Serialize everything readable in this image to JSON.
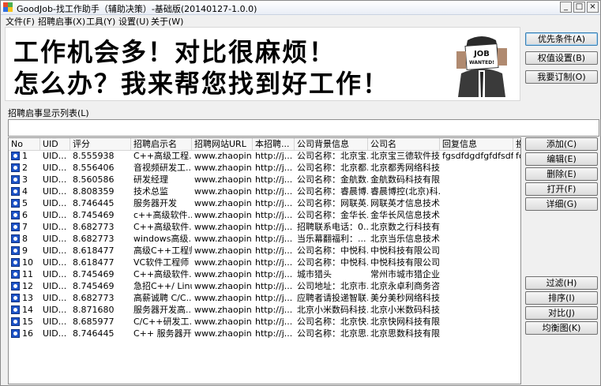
{
  "window": {
    "title": "GoodJob-找工作助手（辅助决策）-基础版(20140127-1.0.0)",
    "minimize": "_",
    "maximize": "□",
    "close": "×"
  },
  "menu": [
    "文件(F)",
    "招聘启事(X)",
    "工具(Y)",
    "设置(U)",
    "关于(W)"
  ],
  "banner": {
    "line1": "工作机会多！对比很麻烦！",
    "line2": "怎么办？我来帮您找到好工作！",
    "sign_text_1": "JOB",
    "sign_text_2": "WANTED!"
  },
  "top_buttons": [
    "优先条件(A)",
    "权值设置(B)",
    "我要订制(O)"
  ],
  "list_label": "招聘启事显示列表(L)",
  "columns": [
    "No",
    "UID",
    "评分",
    "招聘启示名",
    "招聘网站URL",
    "本招聘...",
    "公司背景信息",
    "公司名",
    "回复信息",
    "投"
  ],
  "rows": [
    [
      "1",
      "UID...",
      "8.555938",
      "C++高级工程...",
      "www.zhaopin...",
      "http://j...",
      "公司名称：北京宝...",
      "北京宝三德软件技...",
      "fgsdfdgdfgfdfsdf...",
      "fc"
    ],
    [
      "2",
      "UID...",
      "8.556406",
      "音视频研发工...",
      "www.zhaopin...",
      "http://j...",
      "公司名称：北京都...",
      "北京都秀网络科技...",
      "",
      ""
    ],
    [
      "3",
      "UID...",
      "8.560586",
      "研发经理",
      "www.zhaopin...",
      "http://j...",
      "公司名称：金航数...",
      "金航数码科技有限...",
      "",
      ""
    ],
    [
      "4",
      "UID...",
      "8.808359",
      "技术总监",
      "www.zhaopin...",
      "http://j...",
      "公司名称：睿晨博...",
      "睿晨博控(北京)科...",
      "",
      ""
    ],
    [
      "5",
      "UID...",
      "8.746445",
      "服务器开发",
      "www.zhaopin...",
      "http://j...",
      "公司名称：网联英...",
      "网联英才信息技术...",
      "",
      ""
    ],
    [
      "6",
      "UID...",
      "8.745469",
      "c++高级软件...",
      "www.zhaopin...",
      "http://j...",
      "公司名称：金华长...",
      "金华长风信息技术...",
      "",
      ""
    ],
    [
      "7",
      "UID...",
      "8.682773",
      "C++高级软件...",
      "www.zhaopin...",
      "http://j...",
      "招聘联系电话：0...",
      "北京数之行科技有...",
      "",
      ""
    ],
    [
      "8",
      "UID...",
      "8.682773",
      "windows高级...",
      "www.zhaopin...",
      "http://j...",
      "当乐幕翻福利：...",
      "北京当乐信息技术...",
      "",
      ""
    ],
    [
      "9",
      "UID...",
      "8.618477",
      "高级C++工程师",
      "www.zhaopin...",
      "http://j...",
      "公司名称：中悦科...",
      "中悦科技有限公司",
      "",
      ""
    ],
    [
      "10",
      "UID...",
      "8.618477",
      "VC软件工程师",
      "www.zhaopin...",
      "http://j...",
      "公司名称：中悦科...",
      "中悦科技有限公司",
      "",
      ""
    ],
    [
      "11",
      "UID...",
      "8.745469",
      "C++高级软件...",
      "www.zhaopin...",
      "http://j...",
      "城市猎头",
      "常州市城市猎企业...",
      "",
      ""
    ],
    [
      "12",
      "UID...",
      "8.745469",
      "急招C++/ Linux",
      "www.zhaopin...",
      "http://j...",
      "公司地址：北京市...",
      "北京永卓利商务咨...",
      "",
      ""
    ],
    [
      "13",
      "UID...",
      "8.682773",
      "高薪诚聘 C/C...",
      "www.zhaopin...",
      "http://j...",
      "应聘者请投递智联...",
      "美分美秒网络科技...",
      "",
      ""
    ],
    [
      "14",
      "UID...",
      "8.871680",
      "服务器开发高...",
      "www.zhaopin...",
      "http://j...",
      "北京小米数码科技...",
      "北京小米数码科技...",
      "",
      ""
    ],
    [
      "15",
      "UID...",
      "8.685977",
      "C/C++研发工...",
      "www.zhaopin...",
      "http://j...",
      "公司名称：北京快...",
      "北京快网科技有限...",
      "",
      ""
    ],
    [
      "16",
      "UID...",
      "8.746445",
      "C++ 服务器开...",
      "www.zhaopin...",
      "http://j...",
      "公司名称：北京思...",
      "北京思数科技有限...",
      "",
      ""
    ]
  ],
  "side_buttons": [
    "添加(C)",
    "编辑(E)",
    "删除(E)",
    "打开(F)",
    "详细(G)"
  ],
  "side_buttons2": [
    "过滤(H)",
    "排序(I)",
    "对比(J)",
    "均衡图(K)"
  ]
}
